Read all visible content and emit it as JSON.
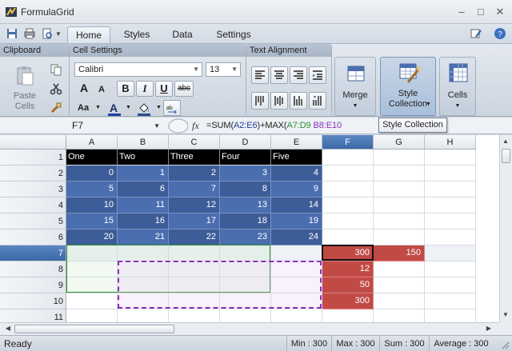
{
  "window": {
    "title": "FormulaGrid"
  },
  "tabs": [
    {
      "label": "Home",
      "active": true
    },
    {
      "label": "Styles",
      "active": false
    },
    {
      "label": "Data",
      "active": false
    },
    {
      "label": "Settings",
      "active": false
    }
  ],
  "ribbon": {
    "clipboard": {
      "header": "Clipboard",
      "paste_label_1": "Paste",
      "paste_label_2": "Cells"
    },
    "cell_settings": {
      "header": "Cell Settings",
      "font_name": "Calibri",
      "font_size": "13",
      "bold": "B",
      "italic": "I",
      "underline": "U",
      "strike": "abc",
      "font_glyph_big": "A",
      "font_glyph_small": "A",
      "case_label": "Aa",
      "font_color_label": "A"
    },
    "text_alignment": {
      "header": "Text Alignment"
    },
    "merge": {
      "label": "Merge"
    },
    "style_collection": {
      "label_1": "Style",
      "label_2": "Collection"
    },
    "cells": {
      "label": "Cells"
    }
  },
  "formula_bar": {
    "name_box": "F7",
    "fx": "fx",
    "prefix": "=SUM(",
    "ref1": "A2:E6",
    "mid": ")+MAX(",
    "ref2": "A7:D9",
    "space": " ",
    "ref3": "B8:E10"
  },
  "tooltip": "Style Collection",
  "grid": {
    "columns": [
      "A",
      "B",
      "C",
      "D",
      "E",
      "F",
      "G",
      "H"
    ],
    "rows": [
      "1",
      "2",
      "3",
      "4",
      "5",
      "6",
      "7",
      "8",
      "9",
      "10",
      "11"
    ],
    "header_row": [
      "One",
      "Two",
      "Three",
      "Four",
      "Five"
    ],
    "data": [
      [
        "0",
        "1",
        "2",
        "3",
        "4"
      ],
      [
        "5",
        "6",
        "7",
        "8",
        "9"
      ],
      [
        "10",
        "11",
        "12",
        "13",
        "14"
      ],
      [
        "15",
        "16",
        "17",
        "18",
        "19"
      ],
      [
        "20",
        "21",
        "22",
        "23",
        "24"
      ]
    ],
    "f_column": [
      "300",
      "12",
      "50",
      "300"
    ],
    "g7": "150"
  },
  "status": {
    "ready": "Ready",
    "min": "Min : 300",
    "max": "Max : 300",
    "sum": "Sum : 300",
    "average": "Average : 300"
  },
  "colors": {
    "accent_blue": "#3d5d98",
    "red_cells": "#c14a45",
    "ref1": "#1f3fa0",
    "ref2": "#2e8b2e",
    "ref3": "#8b2fbf"
  }
}
